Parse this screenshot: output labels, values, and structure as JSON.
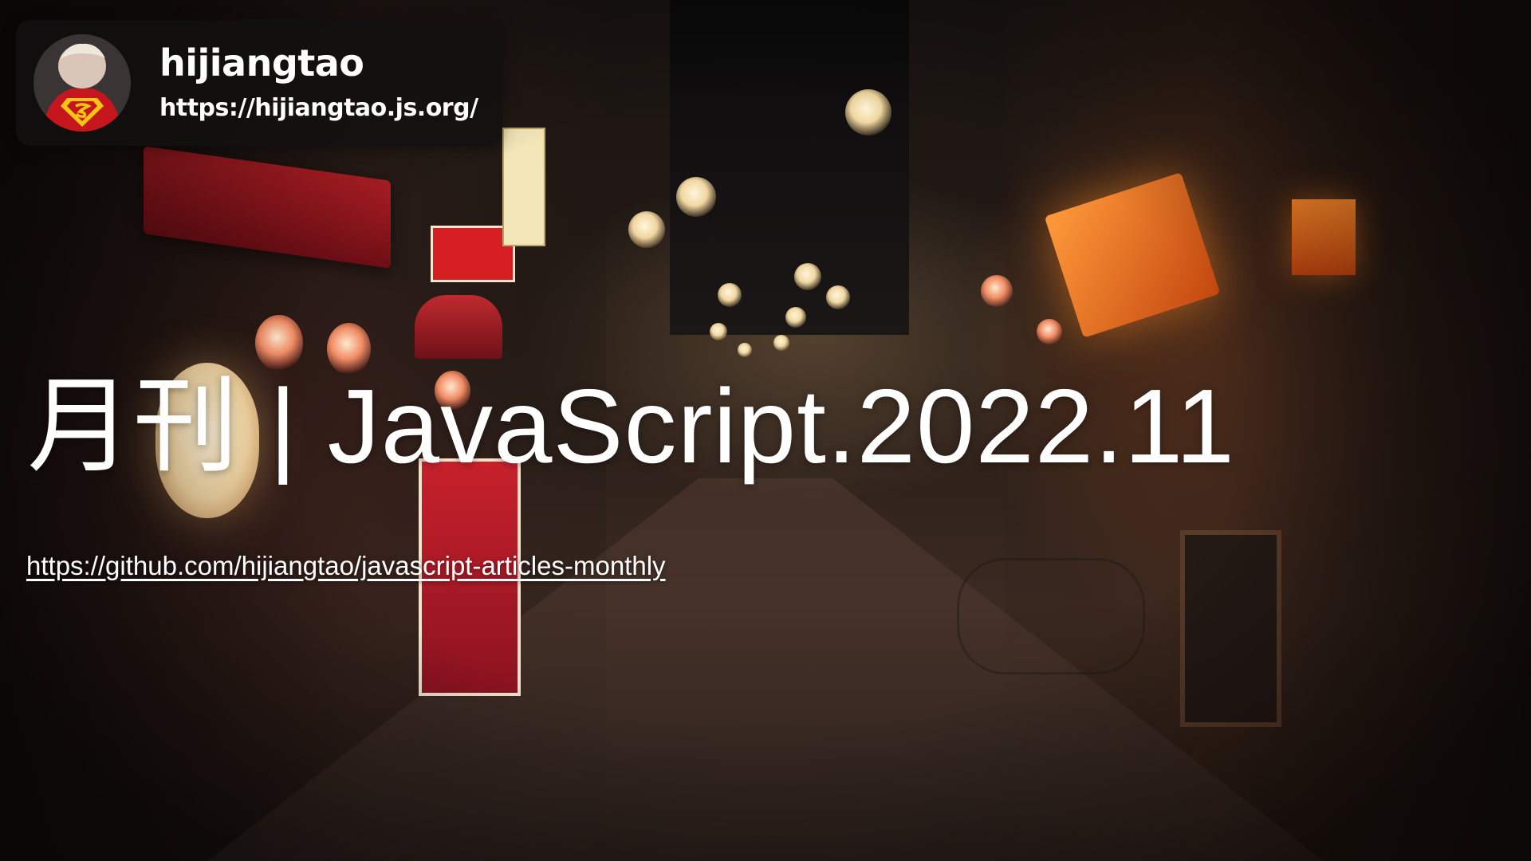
{
  "profile": {
    "name": "hijiangtao",
    "url": "https://hijiangtao.js.org/",
    "avatar_icon": "superman-avatar-icon"
  },
  "title": "月刊 | JavaScript.2022.11",
  "repo_link": {
    "text": "https://github.com/hijiangtao/javascript-articles-monthly"
  },
  "background": {
    "description_icon": "night-street-photo"
  },
  "colors": {
    "card_bg": "#121010",
    "text": "#ffffff",
    "superman_red": "#c4161c",
    "superman_yellow": "#f6c413"
  }
}
